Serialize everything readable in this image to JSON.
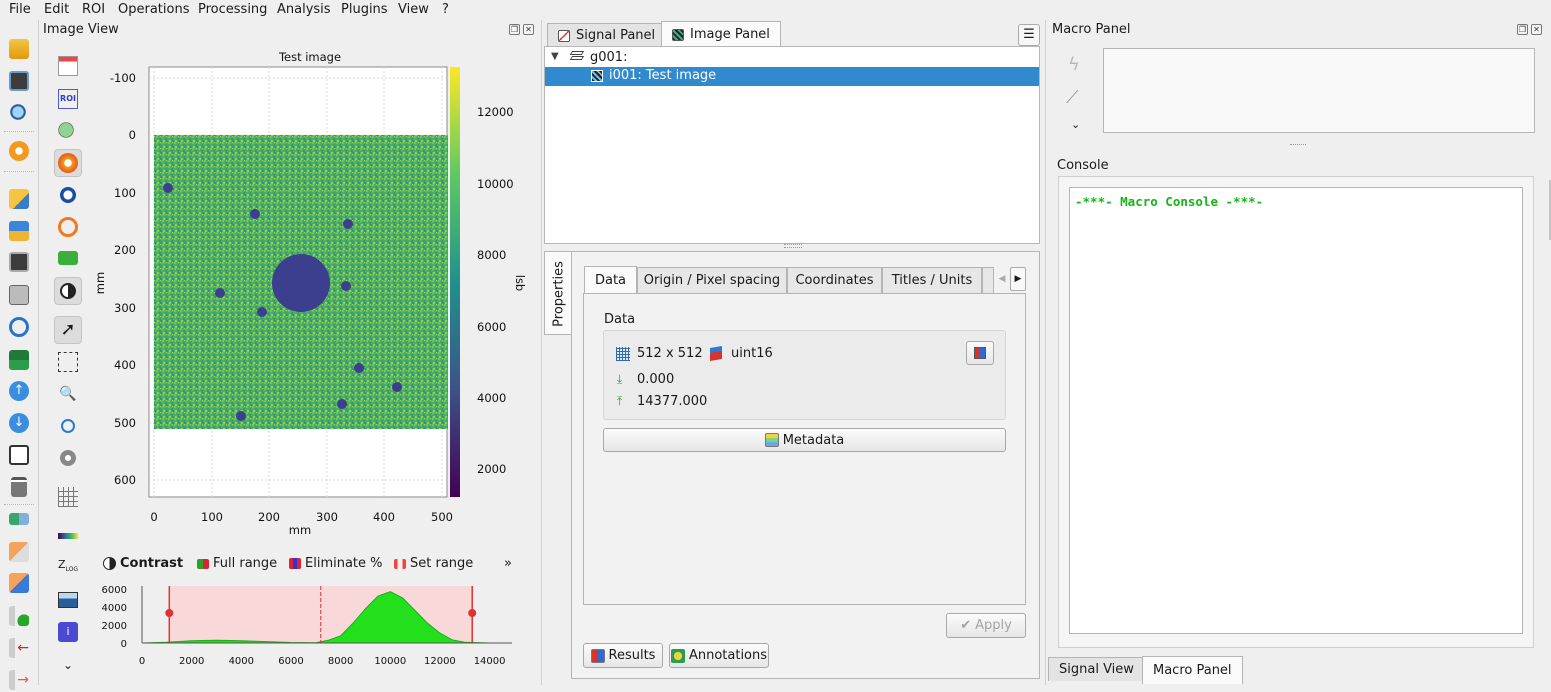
{
  "menu": [
    "File",
    "Edit",
    "ROI",
    "Operations",
    "Processing",
    "Analysis",
    "Plugins",
    "View",
    "?"
  ],
  "image_view": {
    "title": "Image View",
    "plot_title": "Test image",
    "xlabel": "mm",
    "ylabel": "mm",
    "colorbar_label": "lsb",
    "x_ticks": [
      "0",
      "100",
      "200",
      "300",
      "400",
      "500"
    ],
    "y_ticks": [
      "-100",
      "0",
      "100",
      "200",
      "300",
      "400",
      "500",
      "600"
    ],
    "colorbar_ticks": [
      "12000",
      "10000",
      "8000",
      "6000",
      "4000",
      "2000"
    ]
  },
  "contrast": {
    "title": "Contrast",
    "full_range": "Full range",
    "eliminate": "Eliminate %",
    "set_range": "Set range",
    "more": "»",
    "x_ticks": [
      "0",
      "2000",
      "4000",
      "6000",
      "8000",
      "10000",
      "12000",
      "14000"
    ],
    "y_ticks": [
      "6000",
      "4000",
      "2000",
      "0"
    ]
  },
  "chart_data": {
    "type": "area",
    "x": [
      0,
      1000,
      2000,
      3000,
      4000,
      5000,
      6000,
      7000,
      7500,
      8000,
      8500,
      9000,
      9500,
      10000,
      10500,
      11000,
      11500,
      12000,
      12500,
      13000,
      14000
    ],
    "values": [
      0,
      80,
      250,
      300,
      250,
      150,
      50,
      20,
      300,
      800,
      2200,
      3800,
      5200,
      5700,
      5000,
      3600,
      2200,
      1100,
      350,
      80,
      0
    ],
    "xlim": [
      0,
      14500
    ],
    "ylim": [
      0,
      6000
    ],
    "range_min": 1100,
    "range_max": 13300,
    "range_mid": 7200,
    "colors": {
      "fill": "#22e01c",
      "range": "#f8d8d8",
      "marker": "#e03030"
    }
  },
  "panels": {
    "signal_tab": "Signal Panel",
    "image_tab": "Image Panel",
    "tree": {
      "group": "g001:",
      "item": "i001: Test image"
    }
  },
  "properties": {
    "side_tab": "Properties",
    "tabs": [
      "Data",
      "Origin / Pixel spacing",
      "Coordinates",
      "Titles / Units",
      "S"
    ],
    "group_title": "Data",
    "shape": "512 x 512",
    "dtype": "uint16",
    "min": "0.000",
    "max": "14377.000",
    "metadata_button": "Metadata",
    "apply_button": "Apply",
    "results_button": "Results",
    "annotations_button": "Annotations"
  },
  "macro": {
    "title": "Macro Panel",
    "console_label": "Console",
    "console_text": "-***- Macro Console -***-",
    "bottom_tabs": [
      "Signal View",
      "Macro Panel"
    ]
  },
  "colors": {
    "selection": "#3189ce",
    "image_bg": "#4fb26f",
    "blob": "#3a3f8c"
  }
}
